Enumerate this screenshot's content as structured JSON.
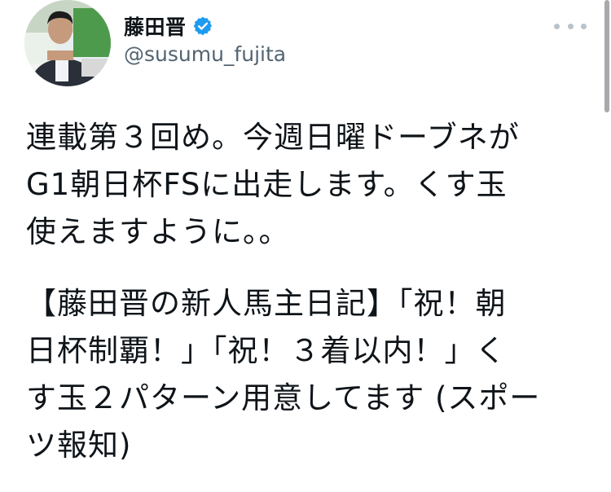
{
  "author": {
    "display_name": "藤田晋",
    "handle": "@susumu_fujita",
    "verified": true,
    "avatar_icon": "profile-photo"
  },
  "menu": {
    "icon": "more-dots-icon"
  },
  "tweet": {
    "paragraph1": "連載第３回め。今週日曜ドーブネが\nG1朝日杯FSに出走します。くす玉\n使えますように。。",
    "paragraph2": "【藤田晋の新人馬主日記】「祝！朝\n日杯制覇！」「祝！３着以内！」く\nす玉２パターン用意してます (スポー\nツ報知)"
  },
  "colors": {
    "text": "#0f1419",
    "handle": "#536471",
    "verified": "#1d9bf0"
  }
}
